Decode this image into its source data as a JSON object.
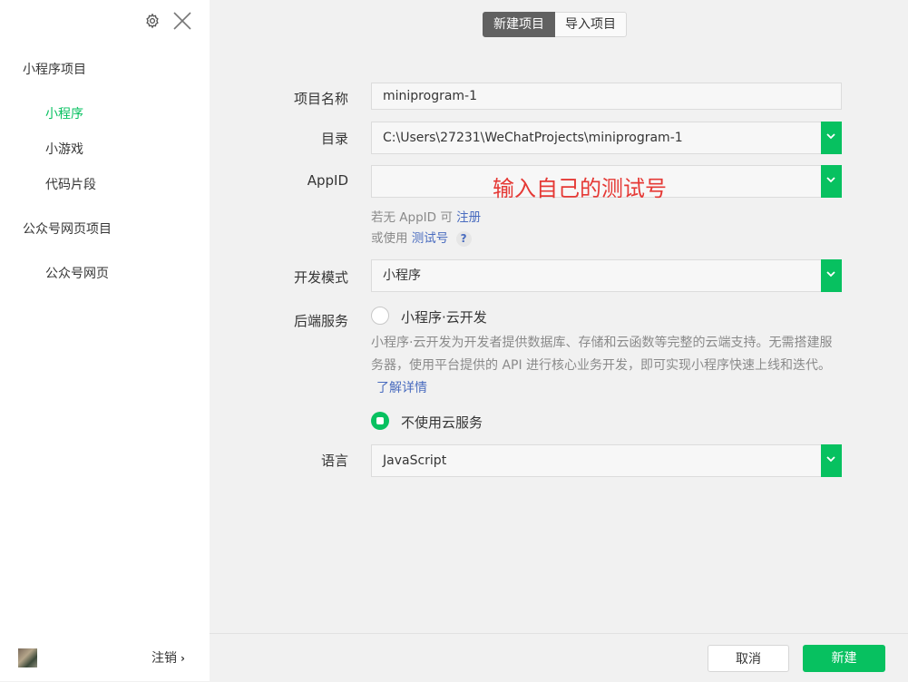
{
  "sidebar": {
    "sections": [
      {
        "label": "小程序项目",
        "items": [
          "小程序",
          "小游戏",
          "代码片段"
        ]
      },
      {
        "label": "公众号网页项目",
        "items": [
          "公众号网页"
        ]
      }
    ],
    "active_item": "小程序",
    "logout_label": "注销",
    "icons": [
      "gear-icon",
      "close-icon",
      "chevron-right-icon"
    ]
  },
  "tabs": {
    "new_project": "新建项目",
    "import_project": "导入项目"
  },
  "form": {
    "project_name": {
      "label": "项目名称",
      "value": "miniprogram-1"
    },
    "directory": {
      "label": "目录",
      "value": "C:\\Users\\27231\\WeChatProjects\\miniprogram-1"
    },
    "appid": {
      "label": "AppID",
      "value": "",
      "annotation": "输入自己的测试号",
      "hint_prefix": "若无 AppID 可",
      "register_link": "注册",
      "alt_prefix": "或使用",
      "test_link": "测试号",
      "help": "?"
    },
    "dev_mode": {
      "label": "开发模式",
      "value": "小程序"
    },
    "backend": {
      "label": "后端服务",
      "option_cloud": "小程序·云开发",
      "description": "小程序·云开发为开发者提供数据库、存储和云函数等完整的云端支持。无需搭建服务器，使用平台提供的 API 进行核心业务开发，即可实现小程序快速上线和迭代。",
      "learn_more": "了解详情",
      "option_none": "不使用云服务",
      "selected": "不使用云服务"
    },
    "language": {
      "label": "语言",
      "value": "JavaScript"
    }
  },
  "footer": {
    "cancel": "取消",
    "create": "新建"
  },
  "colors": {
    "accent": "#07c160",
    "link": "#4a6cbf",
    "annotation": "#e53935",
    "tab_active": "#616161"
  }
}
